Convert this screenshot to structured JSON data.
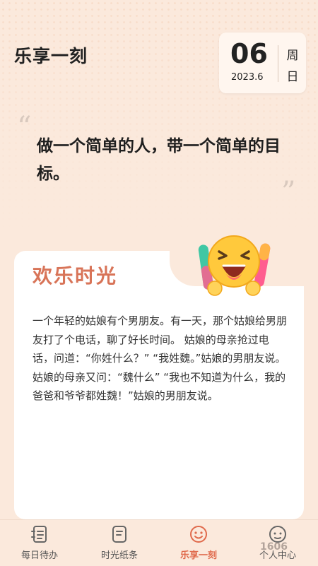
{
  "header": {
    "title": "乐享一刻"
  },
  "date": {
    "day": "06",
    "year_month": "2023.6",
    "weekday_top": "周",
    "weekday_bottom": "日"
  },
  "quote": {
    "text": "做一个简单的人，带一个简单的目标。",
    "open_mark": "“",
    "close_mark": "”"
  },
  "card": {
    "title": "欢乐时光",
    "body": "一个年轻的姑娘有个男朋友。有一天，那个姑娘给男朋友打了个电话，聊了好长时间。 姑娘的母亲抢过电话，问道：“你姓什么？” “我姓魏。”姑娘的男朋友说。姑娘的母亲又问：“魏什么” “我也不知道为什么，我的爸爸和爷爷都姓魏！”姑娘的男朋友说。",
    "emoji_icon": "laughing-face-icon"
  },
  "nav": {
    "items": [
      {
        "label": "每日待办",
        "icon": "todo-list-icon"
      },
      {
        "label": "时光纸条",
        "icon": "note-icon"
      },
      {
        "label": "乐享一刻",
        "icon": "smile-icon",
        "active": true
      },
      {
        "label": "个人中心",
        "icon": "user-face-icon"
      }
    ],
    "active_color": "#e06a4c"
  },
  "watermark": {
    "text": "1606"
  },
  "colors": {
    "background": "#fbe9dc",
    "accent": "#d87458",
    "card": "#ffffff"
  }
}
